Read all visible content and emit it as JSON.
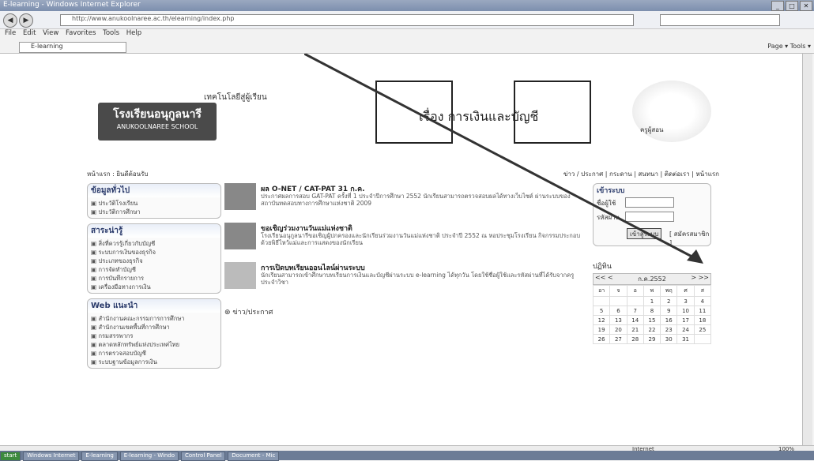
{
  "window": {
    "title": "E-learning - Windows Internet Explorer",
    "controls": [
      "_",
      "□",
      "✕"
    ]
  },
  "address": {
    "url": "http://www.anukoolnaree.ac.th/elearning/index.php",
    "search_placeholder": ""
  },
  "menu": [
    "File",
    "Edit",
    "View",
    "Favorites",
    "Tools",
    "Help"
  ],
  "tab": {
    "label": "E-learning"
  },
  "commandbar": "Page ▾  Tools ▾",
  "banner": {
    "school_th": "โรงเรียนอนุกูลนารี",
    "school_en": "ANUKOOLNAREE SCHOOL",
    "motto": "เทคโนโลยีสู่ผู้เรียน",
    "subject": "เรื่อง การเงินและบัญชี",
    "portrait_caption": "ครูผู้สอน"
  },
  "crumb": {
    "left": "หน้าแรก : ยินดีต้อนรับ",
    "topnav": "ข่าว / ประกาศ | กระดาน | สนทนา | ติดต่อเรา | หน้าแรก"
  },
  "left_panels": [
    {
      "title": "ข้อมูลทั่วไป",
      "items": [
        "ประวัติโรงเรียน",
        "ประวัติการศึกษา"
      ]
    },
    {
      "title": "สาระน่ารู้",
      "items": [
        "สิ่งที่ควรรู้เกี่ยวกับบัญชี",
        "ระบบการเงินของธุรกิจ",
        "ประเภทของธุรกิจ",
        "การจัดทำบัญชี",
        "การบันทึกรายการ",
        "เครื่องมือทางการเงิน"
      ]
    },
    {
      "title": "Web แนะนำ",
      "items": [
        "สำนักงานคณะกรรมการการศึกษา",
        "สำนักงานเขตพื้นที่การศึกษา",
        "กรมสรรพากร",
        "ตลาดหลักทรัพย์แห่งประเทศไทย",
        "การตรวจสอบบัญชี",
        "ระบบฐานข้อมูลการเงิน"
      ]
    }
  ],
  "news": [
    {
      "title": "ผล O-NET / CAT-PAT 31 ก.ค.",
      "body": "ประกาศผลการสอบ GAT-PAT ครั้งที่ 1 ประจำปีการศึกษา 2552 นักเรียนสามารถตรวจสอบผลได้ทางเว็บไซต์ ผ่านระบบของสถาบันทดสอบทางการศึกษาแห่งชาติ 2009"
    },
    {
      "title": "ขอเชิญร่วมงานวันแม่แห่งชาติ",
      "body": "โรงเรียนอนุกูลนารีขอเชิญผู้ปกครองและนักเรียนร่วมงานวันแม่แห่งชาติ ประจำปี 2552 ณ หอประชุมโรงเรียน กิจกรรมประกอบด้วยพิธีไหว้แม่และการแสดงของนักเรียน"
    },
    {
      "title": "การเปิดบทเรียนออนไลน์ผ่านระบบ",
      "body": "นักเรียนสามารถเข้าศึกษาบทเรียนการเงินและบัญชีผ่านระบบ e-learning ได้ทุกวัน โดยใช้ชื่อผู้ใช้และรหัสผ่านที่ได้รับจากครูประจำวิชา"
    }
  ],
  "announce_label": "ข่าว/ประกาศ",
  "login": {
    "title": "เข้าระบบ",
    "user_label": "ชื่อผู้ใช้",
    "pass_label": "รหัสผ่าน",
    "submit": "เข้าสู่ระบบ",
    "register": "[ สมัครสมาชิก ]"
  },
  "calendar": {
    "title": "ปฏิทิน",
    "nav_prev": "<< <",
    "month": "ก.ค.2552",
    "nav_next": "> >>",
    "weekdays": [
      "อา",
      "จ",
      "อ",
      "พ",
      "พฤ",
      "ศ",
      "ส"
    ],
    "weeks": [
      [
        "",
        "",
        "",
        "1",
        "2",
        "3",
        "4"
      ],
      [
        "5",
        "6",
        "7",
        "8",
        "9",
        "10",
        "11"
      ],
      [
        "12",
        "13",
        "14",
        "15",
        "16",
        "17",
        "18"
      ],
      [
        "19",
        "20",
        "21",
        "22",
        "23",
        "24",
        "25"
      ],
      [
        "26",
        "27",
        "28",
        "29",
        "30",
        "31",
        ""
      ]
    ]
  },
  "status": {
    "zone": "Internet",
    "zoom": "100%"
  },
  "taskbar": {
    "start": "start",
    "tasks": [
      "Windows Internet",
      "E-learning",
      "E-learning - Windo",
      "Control Panel",
      "Document - Mic"
    ]
  }
}
